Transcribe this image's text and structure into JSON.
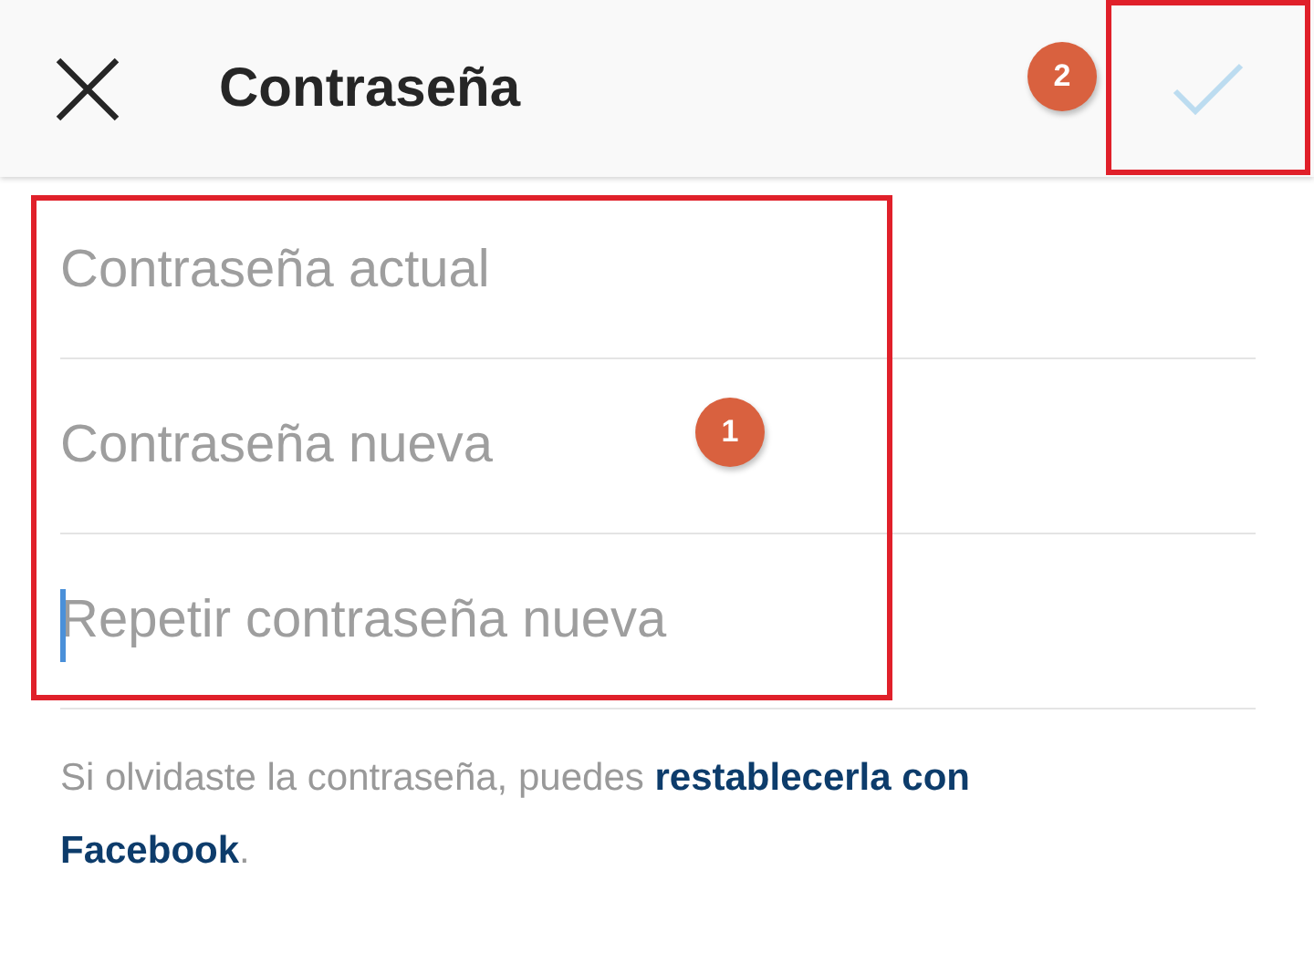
{
  "header": {
    "title": "Contraseña"
  },
  "fields": [
    {
      "placeholder": "Contraseña actual",
      "focused": false
    },
    {
      "placeholder": "Contraseña nueva",
      "focused": false
    },
    {
      "placeholder": "Repetir contraseña nueva",
      "focused": true
    }
  ],
  "help": {
    "text": "Si olvidaste la contraseña, puedes",
    "links": [
      "restablecerla con",
      "Facebook"
    ],
    "end": "."
  },
  "annotations": [
    {
      "label": "1"
    },
    {
      "label": "2"
    }
  ]
}
